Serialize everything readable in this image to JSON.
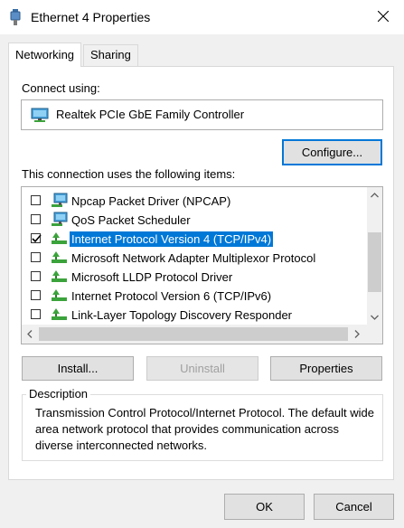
{
  "window": {
    "title": "Ethernet 4 Properties",
    "close_glyph": "✕"
  },
  "tabs": [
    {
      "label": "Networking",
      "active": true
    },
    {
      "label": "Sharing",
      "active": false
    }
  ],
  "connect_using": {
    "label": "Connect using:",
    "adapter": "Realtek PCIe GbE Family Controller",
    "icon": "network-adapter-icon"
  },
  "configure_button": "Configure...",
  "items_label": "This connection uses the following items:",
  "items": [
    {
      "label": "Npcap Packet Driver (NPCAP)",
      "checked": false,
      "icon": "network-client-icon"
    },
    {
      "label": "QoS Packet Scheduler",
      "checked": false,
      "icon": "network-client-icon"
    },
    {
      "label": "Internet Protocol Version 4 (TCP/IPv4)",
      "checked": true,
      "selected": true,
      "icon": "protocol-icon"
    },
    {
      "label": "Microsoft Network Adapter Multiplexor Protocol",
      "checked": false,
      "icon": "protocol-icon"
    },
    {
      "label": "Microsoft LLDP Protocol Driver",
      "checked": false,
      "icon": "protocol-icon"
    },
    {
      "label": "Internet Protocol Version 6 (TCP/IPv6)",
      "checked": false,
      "icon": "protocol-icon"
    },
    {
      "label": "Link-Layer Topology Discovery Responder",
      "checked": false,
      "icon": "protocol-icon"
    }
  ],
  "buttons": {
    "install": "Install...",
    "uninstall": "Uninstall",
    "properties": "Properties"
  },
  "description": {
    "legend": "Description",
    "text": "Transmission Control Protocol/Internet Protocol. The default wide area network protocol that provides communication across diverse interconnected networks."
  },
  "footer": {
    "ok": "OK",
    "cancel": "Cancel"
  },
  "colors": {
    "accent": "#0078d7",
    "selected_bg": "#0078d7"
  }
}
